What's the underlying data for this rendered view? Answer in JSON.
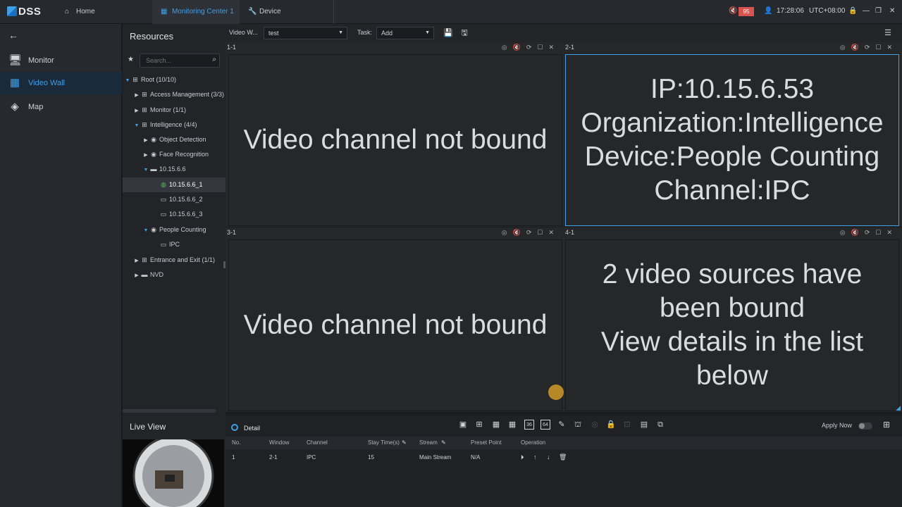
{
  "app": {
    "logo": "DSS"
  },
  "top_tabs": [
    {
      "label": "Home",
      "icon": "home-icon"
    },
    {
      "label": "Monitoring Center 1",
      "icon": "grid-icon"
    },
    {
      "label": "Device",
      "icon": "wrench-icon"
    }
  ],
  "status": {
    "badge": "95",
    "time": "17:28:06",
    "timezone": "UTC+08:00"
  },
  "nav": {
    "back_icon": "arrow-left-icon",
    "items": [
      {
        "label": "Monitor",
        "icon": "monitor-icon"
      },
      {
        "label": "Video Wall",
        "icon": "video-wall-icon"
      },
      {
        "label": "Map",
        "icon": "map-icon"
      }
    ]
  },
  "resources": {
    "title": "Resources",
    "search_placeholder": "Search...",
    "tree": [
      {
        "label": "Root (10/10)"
      },
      {
        "label": "Access Management (3/3)"
      },
      {
        "label": "Monitor (1/1)"
      },
      {
        "label": "Intelligence (4/4)"
      },
      {
        "label": "Object Detection"
      },
      {
        "label": "Face Recognition"
      },
      {
        "label": "10.15.6.6"
      },
      {
        "label": "10.15.6.6_1"
      },
      {
        "label": "10.15.6.6_2"
      },
      {
        "label": "10.15.6.6_3"
      },
      {
        "label": "People Counting"
      },
      {
        "label": "IPC"
      },
      {
        "label": "Entrance and Exit (1/1)"
      },
      {
        "label": "NVD"
      }
    ]
  },
  "toolbar": {
    "video_wall_label": "Video W...",
    "video_wall_value": "test",
    "task_label": "Task:",
    "task_value": "Add"
  },
  "windows": [
    {
      "id": "1-1",
      "text": "Video channel not bound"
    },
    {
      "id": "2-1",
      "text": "IP:10.15.6.53\nOrganization:Intelligence\nDevice:People Counting\nChannel:IPC"
    },
    {
      "id": "3-1",
      "text": "Video channel not bound"
    },
    {
      "id": "4-1",
      "text": "2 video sources have been bound\nView details in the list below"
    }
  ],
  "live_view": {
    "title": "Live View"
  },
  "detail": {
    "tab": "Detail",
    "apply_now": "Apply Now",
    "layouts": [
      "1",
      "4",
      "9",
      "16",
      "36",
      "64"
    ],
    "columns": [
      "No.",
      "Window",
      "Channel",
      "Stay Time(s)",
      "Stream",
      "Preset Point",
      "Operation"
    ],
    "rows": [
      {
        "no": "1",
        "window": "2-1",
        "channel": "IPC",
        "stay": "15",
        "stream": "Main Stream",
        "preset": "N/A"
      }
    ]
  }
}
